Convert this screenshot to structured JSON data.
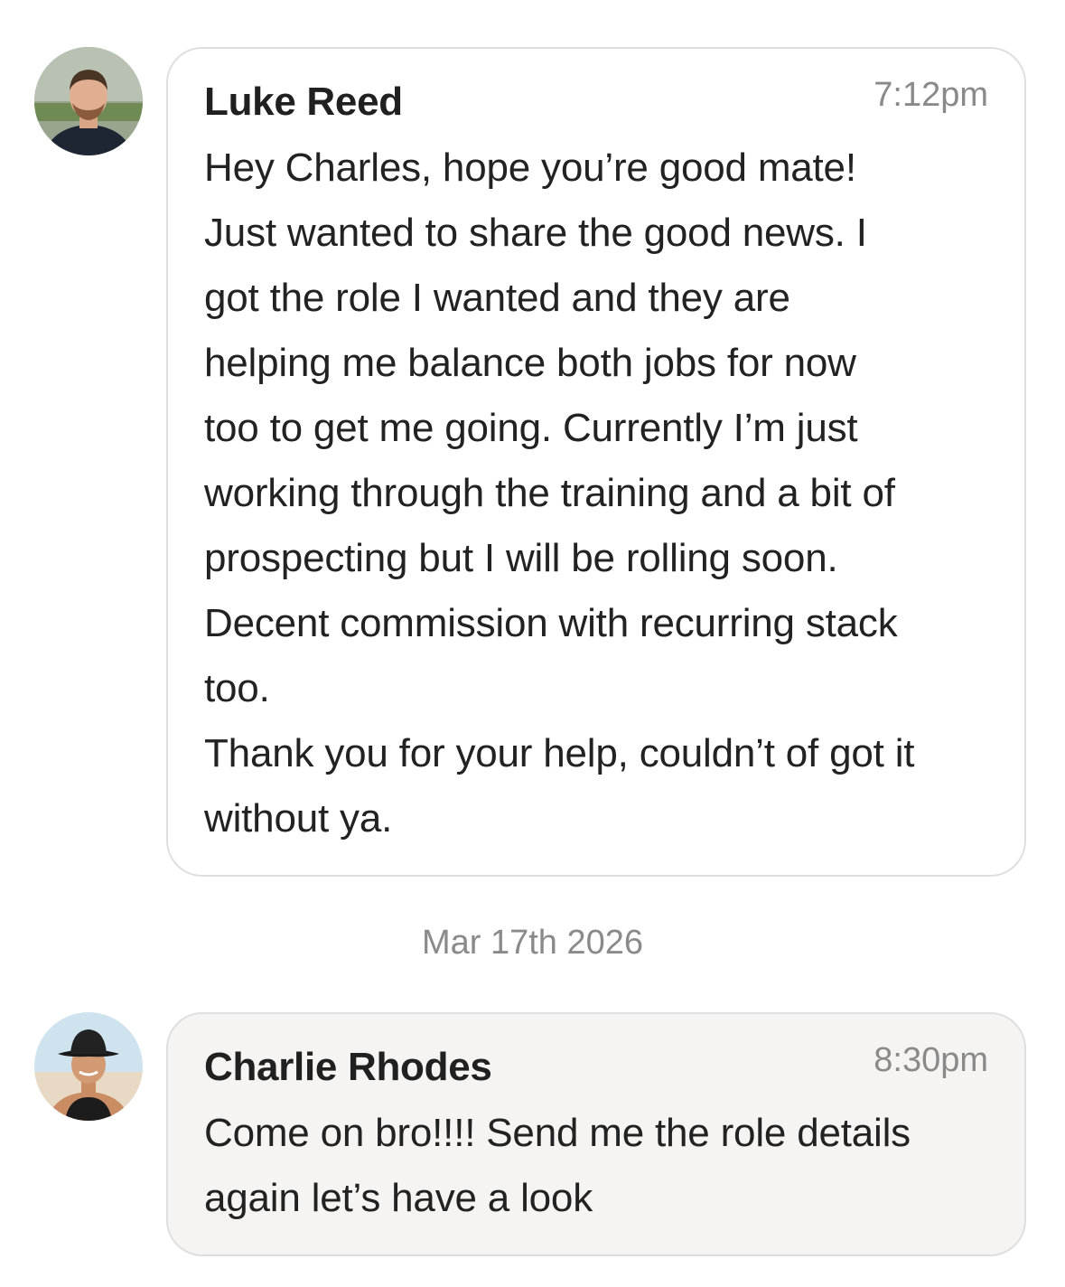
{
  "messages": [
    {
      "sender": "Luke Reed",
      "time": "7:12pm",
      "avatar_icon": "user-avatar-luke-icon",
      "text": "Hey Charles, hope you’re good mate!\nJust wanted to share the good news. I\ngot the role I wanted and they are\nhelping me balance both jobs for now\ntoo to get me going. Currently I’m just\nworking through the training and a bit of\nprospecting but I will be rolling soon.\nDecent commission with recurring stack\ntoo.\nThank you for your help, couldn’t of got it\nwithout ya."
    },
    {
      "sender": "Charlie Rhodes",
      "time": "8:30pm",
      "avatar_icon": "user-avatar-charlie-icon",
      "text": "Come on bro!!!! Send me the role details\nagain let’s have a look"
    }
  ],
  "date_separator": "Mar 17th 2026",
  "colors": {
    "bubble_border": "#dedede",
    "bubble_shaded_bg": "#f5f4f2",
    "timestamp": "#8a8a8a",
    "text": "#222222"
  }
}
